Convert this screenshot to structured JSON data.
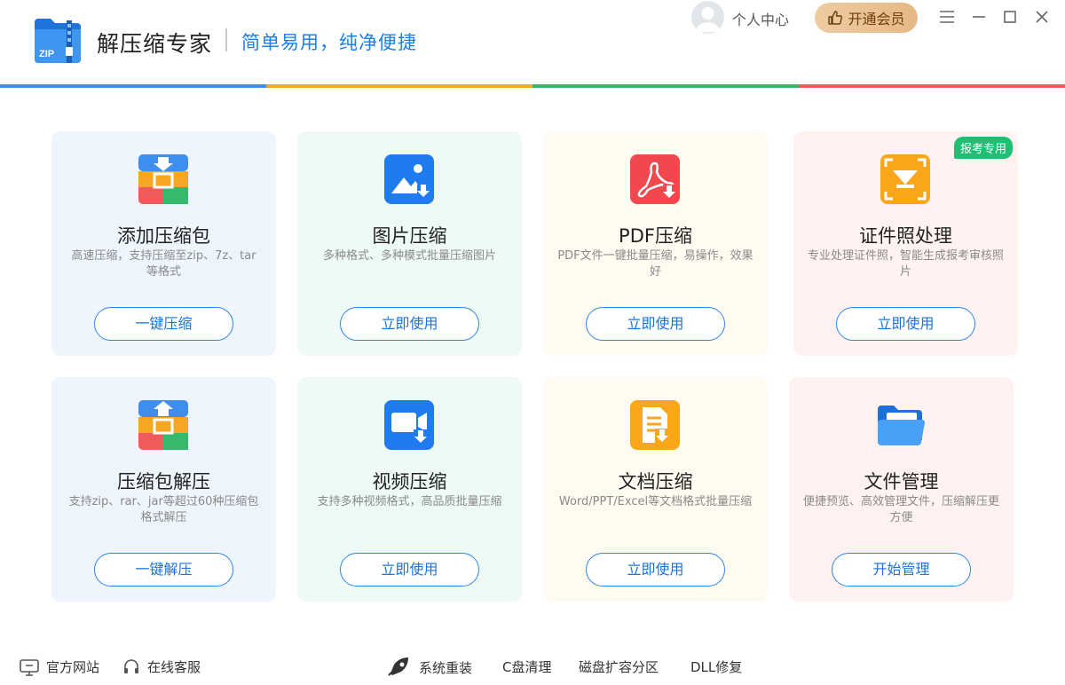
{
  "header": {
    "app_title": "解压缩专家",
    "slogan": "简单易用，纯净便捷",
    "user_center": "个人中心",
    "vip_label": "开通会员"
  },
  "rainbow_colors": [
    "#3b8ff3",
    "#f5a623",
    "#35b96c",
    "#f05a5a"
  ],
  "cards": [
    {
      "title": "添加压缩包",
      "desc": "高速压缩，支持压缩至zip、7z、tar等格式",
      "button": "一键压缩",
      "bg": "#eef5fd",
      "icon": "add-archive-icon"
    },
    {
      "title": "图片压缩",
      "desc": "多种格式、多种模式批量压缩图片",
      "button": "立即使用",
      "bg": "#eefaf5",
      "icon": "image-compress-icon"
    },
    {
      "title": "PDF压缩",
      "desc": "PDF文件一键批量压缩，易操作，效果好",
      "button": "立即使用",
      "bg": "#fffbf0",
      "icon": "pdf-compress-icon"
    },
    {
      "title": "证件照处理",
      "desc": "专业处理证件照，智能生成报考审核照片",
      "button": "立即使用",
      "bg": "#fff2f1",
      "icon": "id-photo-icon",
      "badge": "报考专用"
    },
    {
      "title": "压缩包解压",
      "desc": "支持zip、rar、jar等超过60种压缩包格式解压",
      "button": "一键解压",
      "bg": "#eef5fd",
      "icon": "extract-archive-icon"
    },
    {
      "title": "视频压缩",
      "desc": "支持多种视频格式，高品质批量压缩",
      "button": "立即使用",
      "bg": "#eefaf5",
      "icon": "video-compress-icon"
    },
    {
      "title": "文档压缩",
      "desc": "Word/PPT/Excel等文档格式批量压缩",
      "button": "立即使用",
      "bg": "#fffbf0",
      "icon": "document-compress-icon"
    },
    {
      "title": "文件管理",
      "desc": "便捷预览、高效管理文件，压缩解压更方便",
      "button": "开始管理",
      "bg": "#fff2f1",
      "icon": "file-manage-icon"
    }
  ],
  "footer": {
    "website": "官方网站",
    "support": "在线客服",
    "reinstall": "系统重装",
    "c_clean": "C盘清理",
    "disk_expand": "磁盘扩容分区",
    "dll_repair": "DLL修复"
  }
}
